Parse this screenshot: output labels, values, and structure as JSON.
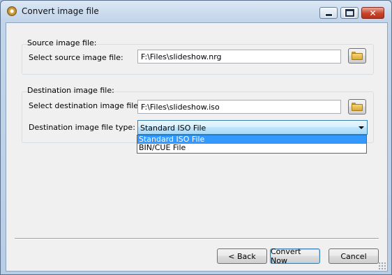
{
  "window": {
    "title": "Convert image file",
    "app_icon": "disc-icon",
    "controls": {
      "minimize": "minimize-icon",
      "maximize": "maximize-icon",
      "close": "close-icon",
      "close_glyph": "✕"
    }
  },
  "source": {
    "group_title": "Source image file:",
    "label": "Select source image file:",
    "path": "F:\\Files\\slideshow.nrg",
    "browse_icon": "folder-icon"
  },
  "destination": {
    "group_title": "Destination image file:",
    "label": "Select destination image file:",
    "path": "F:\\Files\\slideshow.iso",
    "browse_icon": "folder-icon",
    "type_label": "Destination image file type:",
    "type_selected": "Standard ISO File",
    "type_options": [
      "Standard ISO File",
      "BIN/CUE File"
    ]
  },
  "buttons": {
    "back": "< Back",
    "convert": "Convert Now",
    "cancel": "Cancel"
  },
  "colors": {
    "selection": "#3399ff",
    "client_bg": "#f0f0f0",
    "close_button": "#c7442b"
  }
}
